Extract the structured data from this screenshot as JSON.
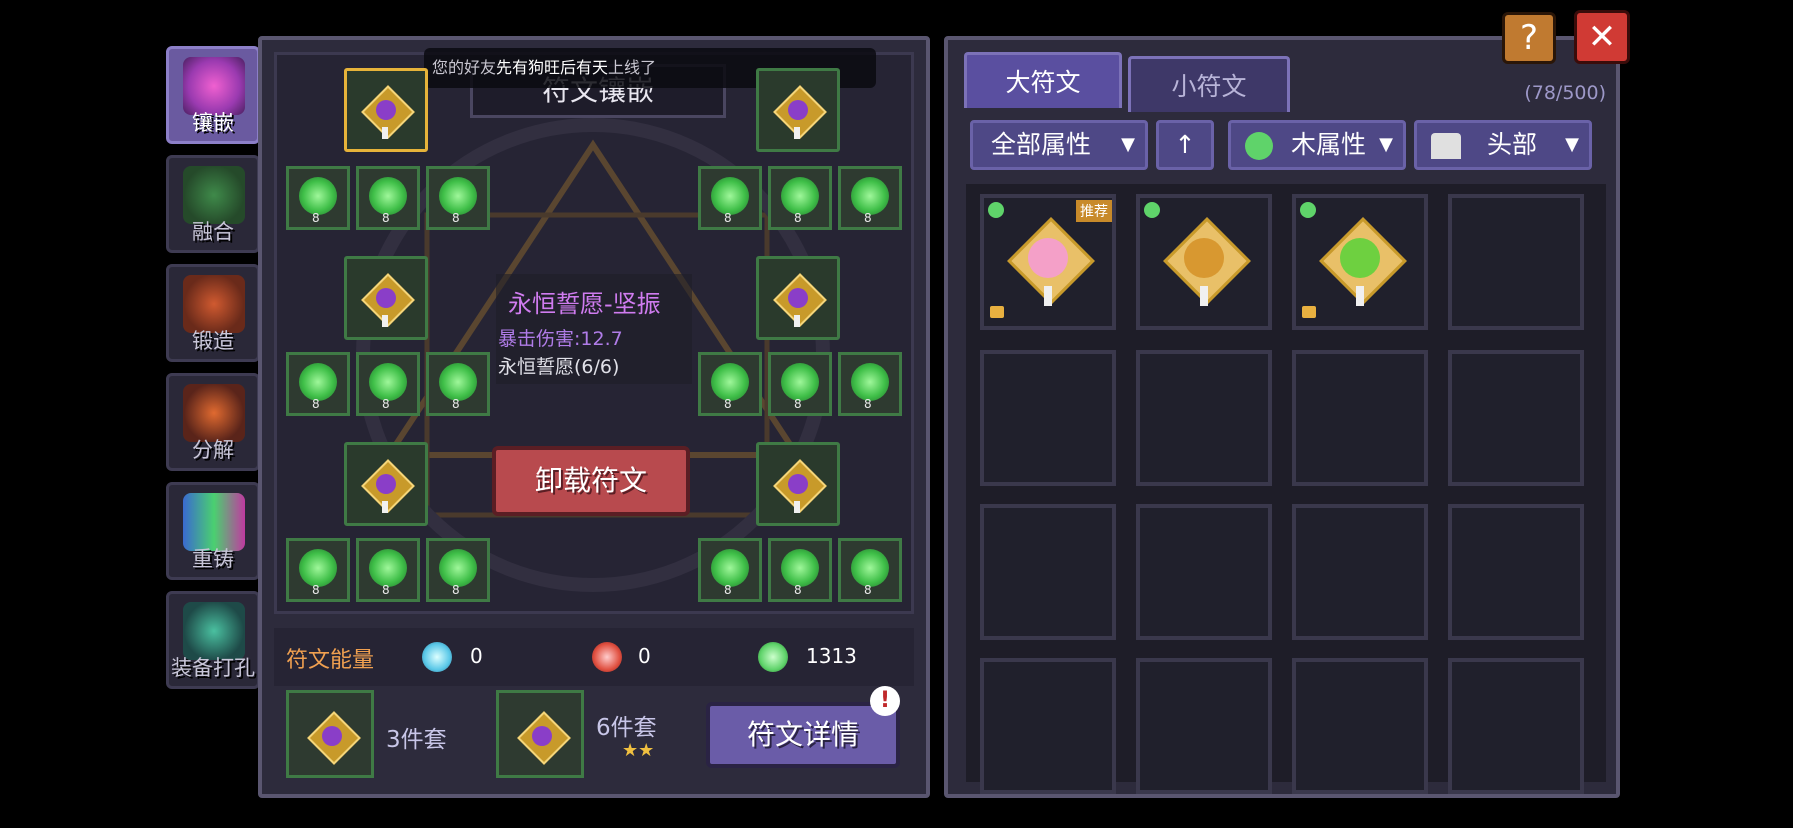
{
  "side_tabs": [
    {
      "label": "镶嵌",
      "active": true
    },
    {
      "label": "融合",
      "active": false
    },
    {
      "label": "锻造",
      "active": false
    },
    {
      "label": "分解",
      "active": false
    },
    {
      "label": "重铸",
      "active": false
    },
    {
      "label": "装备打孔",
      "active": false
    }
  ],
  "board": {
    "title": "符文镶嵌",
    "notice": {
      "prefix": "您的好友",
      "name": "先有狗旺后有天",
      "suffix": "上线了"
    },
    "gem_level": "8",
    "rune_info": {
      "name": "永恒誓愿-坚振",
      "stat": "暴击伤害:12.7",
      "set": "永恒誓愿(6/6)"
    },
    "unload_button": "卸载符文"
  },
  "energy": {
    "label": "符文能量",
    "blue_value": "0",
    "red_value": "0",
    "green_value": "1313"
  },
  "sets": {
    "set3_label": "3件套",
    "set6_label": "6件套",
    "set6_stars": "★★",
    "detail_button": "符文详情",
    "detail_badge": "!"
  },
  "right": {
    "tab_big": "大符文",
    "tab_small": "小符文",
    "count": "(78/500)",
    "filter_all": "全部属性",
    "filter_sort": "↑",
    "filter_element": "木属性",
    "filter_slot": "头部",
    "recommend_badge": "推荐"
  },
  "header": {
    "help": "?",
    "close": "✕"
  },
  "colors": {
    "accent": "#6a5ca8",
    "wood": "#5fd36a",
    "danger": "#b84a4e",
    "gold": "#e6b33a"
  }
}
